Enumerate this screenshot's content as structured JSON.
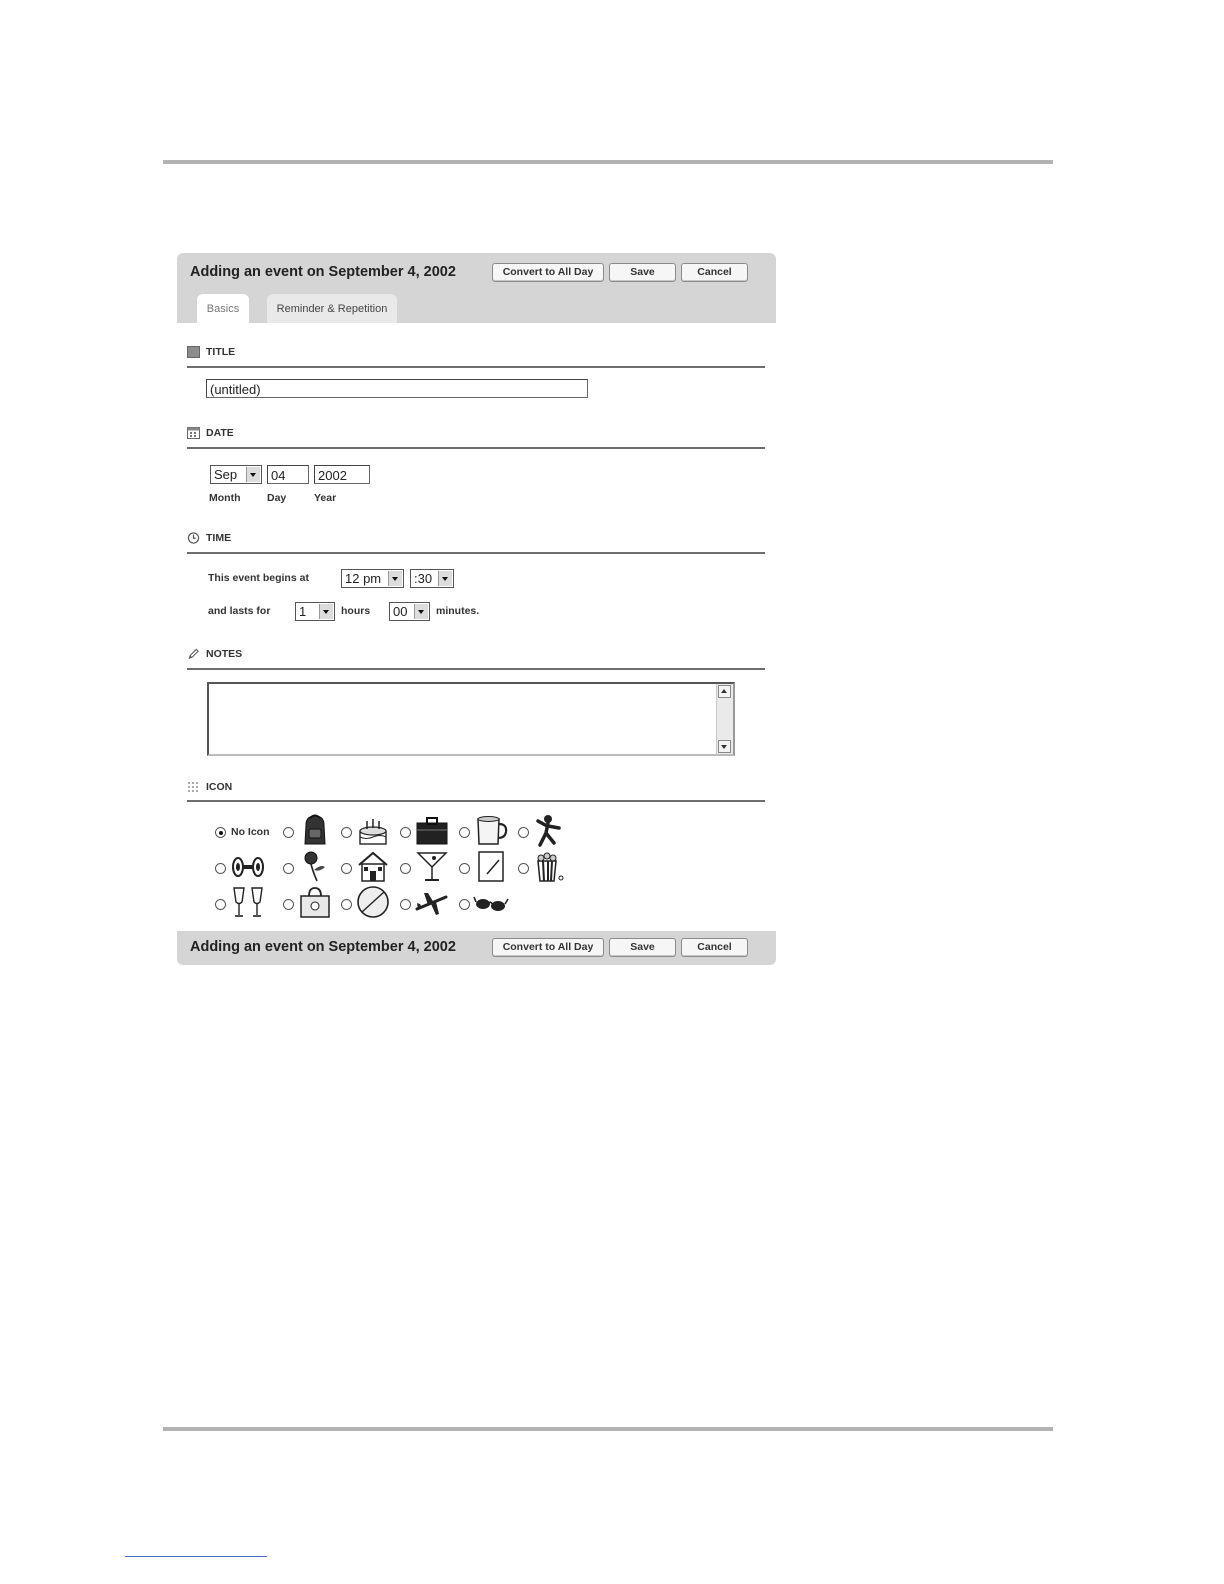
{
  "dialog": {
    "title": "Adding an event on September 4, 2002",
    "buttons": {
      "convert": "Convert to All Day",
      "save": "Save",
      "cancel": "Cancel"
    }
  },
  "tabs": [
    {
      "label": "Basics",
      "active": true
    },
    {
      "label": "Reminder & Repetition",
      "active": false
    }
  ],
  "sections": {
    "title": {
      "label": "TITLE",
      "value": "(untitled)"
    },
    "date": {
      "label": "DATE",
      "month": "Sep",
      "day": "04",
      "year": "2002",
      "month_label": "Month",
      "day_label": "Day",
      "year_label": "Year"
    },
    "time": {
      "label": "TIME",
      "begins_label": "This event begins at",
      "hour": "12 pm",
      "minute": ":30",
      "lasts_label": "and lasts for",
      "hours_value": "1",
      "hours_label": "hours",
      "minutes_value": "00",
      "minutes_label": "minutes."
    },
    "notes": {
      "label": "NOTES",
      "value": ""
    },
    "icon": {
      "label": "ICON",
      "no_icon_label": "No Icon",
      "selected": "none",
      "options": [
        "backpack-icon",
        "birthday-cake-icon",
        "briefcase-icon",
        "coffee-mug-icon",
        "dancer-icon",
        "dumbbell-icon",
        "rose-icon",
        "house-icon",
        "martini-icon",
        "notepad-icon",
        "popcorn-icon",
        "champagne-glasses-icon",
        "shopping-bag-icon",
        "baseball-icon",
        "airplane-icon",
        "sunglasses-icon"
      ]
    }
  }
}
